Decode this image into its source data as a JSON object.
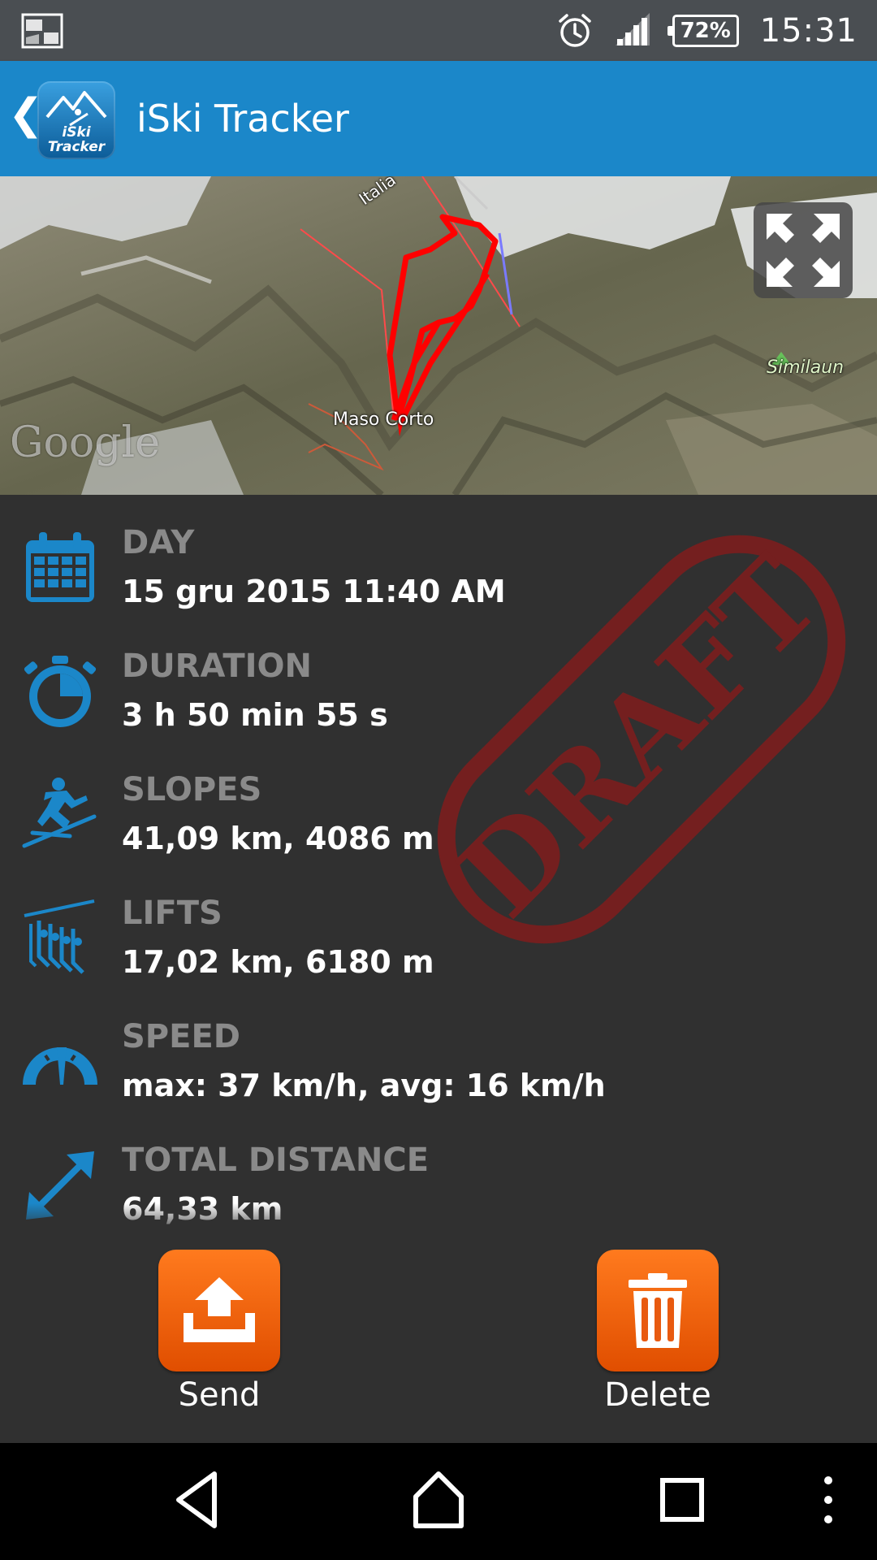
{
  "status_bar": {
    "battery": "72%",
    "time": "15:31",
    "signal_roaming": "R",
    "icons": [
      "notification-icon",
      "alarm-icon",
      "signal-icon",
      "battery-icon"
    ]
  },
  "app_bar": {
    "title": "iSki Tracker",
    "logo_text_line1": "iSki",
    "logo_text_line2": "Tracker",
    "color": "#1b87c9"
  },
  "map": {
    "labels": {
      "town": "Maso Corto",
      "peak": "Similaun",
      "region": "Italia",
      "google": "Google"
    },
    "track_color": "#ff0000"
  },
  "stats": [
    {
      "label": "DAY",
      "value": "15 gru 2015 11:40 AM",
      "icon": "calendar-icon"
    },
    {
      "label": "DURATION",
      "value": "3 h 50 min 55 s",
      "icon": "stopwatch-icon"
    },
    {
      "label": "SLOPES",
      "value": "41,09 km, 4086 m",
      "icon": "skier-icon"
    },
    {
      "label": "LIFTS",
      "value": "17,02 km, 6180 m",
      "icon": "chairlift-icon"
    },
    {
      "label": "SPEED",
      "value": "max: 37 km/h, avg: 16 km/h",
      "icon": "speedometer-icon"
    },
    {
      "label": "TOTAL DISTANCE",
      "value": "64,33 km",
      "icon": "distance-arrow-icon"
    }
  ],
  "stamp": {
    "text": "DRAFT",
    "color": "#8b1a1a"
  },
  "actions": {
    "send_label": "Send",
    "delete_label": "Delete",
    "color": "#f06010"
  },
  "nav": [
    "back-icon",
    "home-icon",
    "recents-icon",
    "overflow-menu-icon"
  ],
  "colors": {
    "background": "#303030",
    "label_gray": "#8a8a8a",
    "icon_blue": "#1b87c9"
  }
}
